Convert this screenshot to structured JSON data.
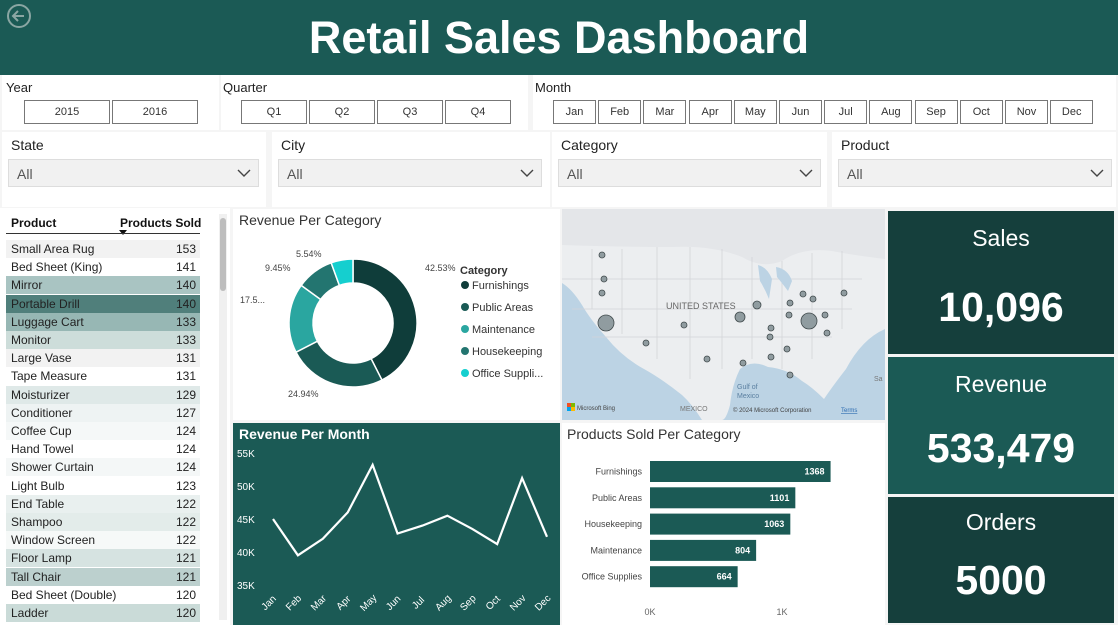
{
  "header": {
    "title": "Retail Sales Dashboard",
    "back_icon": "back-arrow-icon"
  },
  "slicers": {
    "year": {
      "label": "Year",
      "options": [
        "2015",
        "2016"
      ]
    },
    "quarter": {
      "label": "Quarter",
      "options": [
        "Q1",
        "Q2",
        "Q3",
        "Q4"
      ]
    },
    "month": {
      "label": "Month",
      "options": [
        "Jan",
        "Feb",
        "Mar",
        "Apr",
        "May",
        "Jun",
        "Jul",
        "Aug",
        "Sep",
        "Oct",
        "Nov",
        "Dec"
      ]
    }
  },
  "filters": [
    {
      "label": "State",
      "value": "All"
    },
    {
      "label": "City",
      "value": "All"
    },
    {
      "label": "Category",
      "value": "All"
    },
    {
      "label": "Product",
      "value": "All"
    }
  ],
  "product_table": {
    "col_product": "Product",
    "col_sold": "Products Sold",
    "rows": [
      {
        "name": "Small Area Rug",
        "sold": "153",
        "shade": "#f2f2f2"
      },
      {
        "name": "Bed Sheet (King)",
        "sold": "141",
        "shade": "#ffffff"
      },
      {
        "name": "Mirror",
        "sold": "140",
        "shade": "#a9c4c2"
      },
      {
        "name": "Portable Drill",
        "sold": "140",
        "shade": "#507f7b"
      },
      {
        "name": "Luggage Cart",
        "sold": "133",
        "shade": "#97b7b4"
      },
      {
        "name": "Monitor",
        "sold": "133",
        "shade": "#cdddda"
      },
      {
        "name": "Large Vase",
        "sold": "131",
        "shade": "#f2f2f2"
      },
      {
        "name": "Tape Measure",
        "sold": "131",
        "shade": "#ffffff"
      },
      {
        "name": "Moisturizer",
        "sold": "129",
        "shade": "#dfe9e8"
      },
      {
        "name": "Conditioner",
        "sold": "127",
        "shade": "#eef3f3"
      },
      {
        "name": "Coffee Cup",
        "sold": "124",
        "shade": "#f5f8f8"
      },
      {
        "name": "Hand Towel",
        "sold": "124",
        "shade": "#ffffff"
      },
      {
        "name": "Shower Curtain",
        "sold": "124",
        "shade": "#f4f7f7"
      },
      {
        "name": "Light Bulb",
        "sold": "123",
        "shade": "#ffffff"
      },
      {
        "name": "End Table",
        "sold": "122",
        "shade": "#e9f0ef"
      },
      {
        "name": "Shampoo",
        "sold": "122",
        "shade": "#e3ecea"
      },
      {
        "name": "Window Screen",
        "sold": "122",
        "shade": "#f6f9f8"
      },
      {
        "name": "Floor Lamp",
        "sold": "121",
        "shade": "#d6e3e1"
      },
      {
        "name": "Tall Chair",
        "sold": "121",
        "shade": "#bcd0ce"
      },
      {
        "name": "Bed Sheet (Double)",
        "sold": "120",
        "shade": "#ffffff"
      },
      {
        "name": "Ladder",
        "sold": "120",
        "shade": "#cadbd8"
      }
    ]
  },
  "revenue_per_category": {
    "title": "Revenue Per Category",
    "legend_title": "Category",
    "slices": [
      {
        "name": "Furnishings",
        "pct": 42.53,
        "label": "42.53%",
        "color": "#0f3d3a"
      },
      {
        "name": "Public Areas",
        "pct": 24.94,
        "label": "24.94%",
        "color": "#1a5a55"
      },
      {
        "name": "Maintenance",
        "pct": 17.54,
        "label": "17.5...",
        "color": "#2aa6a0"
      },
      {
        "name": "Housekeeping",
        "pct": 9.45,
        "label": "9.45%",
        "color": "#237570"
      },
      {
        "name": "Office Suppli...",
        "pct": 5.54,
        "label": "5.54%",
        "color": "#15cfcf"
      }
    ]
  },
  "map": {
    "country_label": "UNITED STATES",
    "mexico": "MEXICO",
    "gulf": "Gulf of\nMexico",
    "gulf1": "Gulf of",
    "gulf2": "Mexico",
    "sa": "Sa",
    "bing": "Microsoft Bing",
    "copyright": "© 2024 Microsoft Corporation",
    "terms": "Terms"
  },
  "kpis": [
    {
      "label": "Sales",
      "value": "10,096",
      "bg": "#153f3c"
    },
    {
      "label": "Revenue",
      "value": "533,479",
      "bg": "#1b5a55"
    },
    {
      "label": "Orders",
      "value": "5000",
      "bg": "#153f3c"
    }
  ],
  "chart_data": [
    {
      "type": "line",
      "title": "Revenue Per Month",
      "categories": [
        "Jan",
        "Feb",
        "Mar",
        "Apr",
        "May",
        "Jun",
        "Jul",
        "Aug",
        "Sep",
        "Oct",
        "Nov",
        "Dec"
      ],
      "values": [
        45000,
        39500,
        42000,
        46000,
        53200,
        42800,
        44000,
        45500,
        43500,
        41200,
        51200,
        42300
      ],
      "ylim": [
        35000,
        55000
      ],
      "yticks": [
        "35K",
        "40K",
        "45K",
        "50K",
        "55K"
      ]
    },
    {
      "type": "bar",
      "orientation": "horizontal",
      "title": "Products Sold Per Category",
      "categories": [
        "Furnishings",
        "Public Areas",
        "Housekeeping",
        "Maintenance",
        "Office Supplies"
      ],
      "values": [
        1368,
        1101,
        1063,
        804,
        664
      ],
      "value_labels": [
        "1368",
        "1101",
        "1063",
        "804",
        "664"
      ],
      "xlim": [
        0,
        1500
      ],
      "xticks": [
        "0K",
        "1K"
      ]
    }
  ]
}
